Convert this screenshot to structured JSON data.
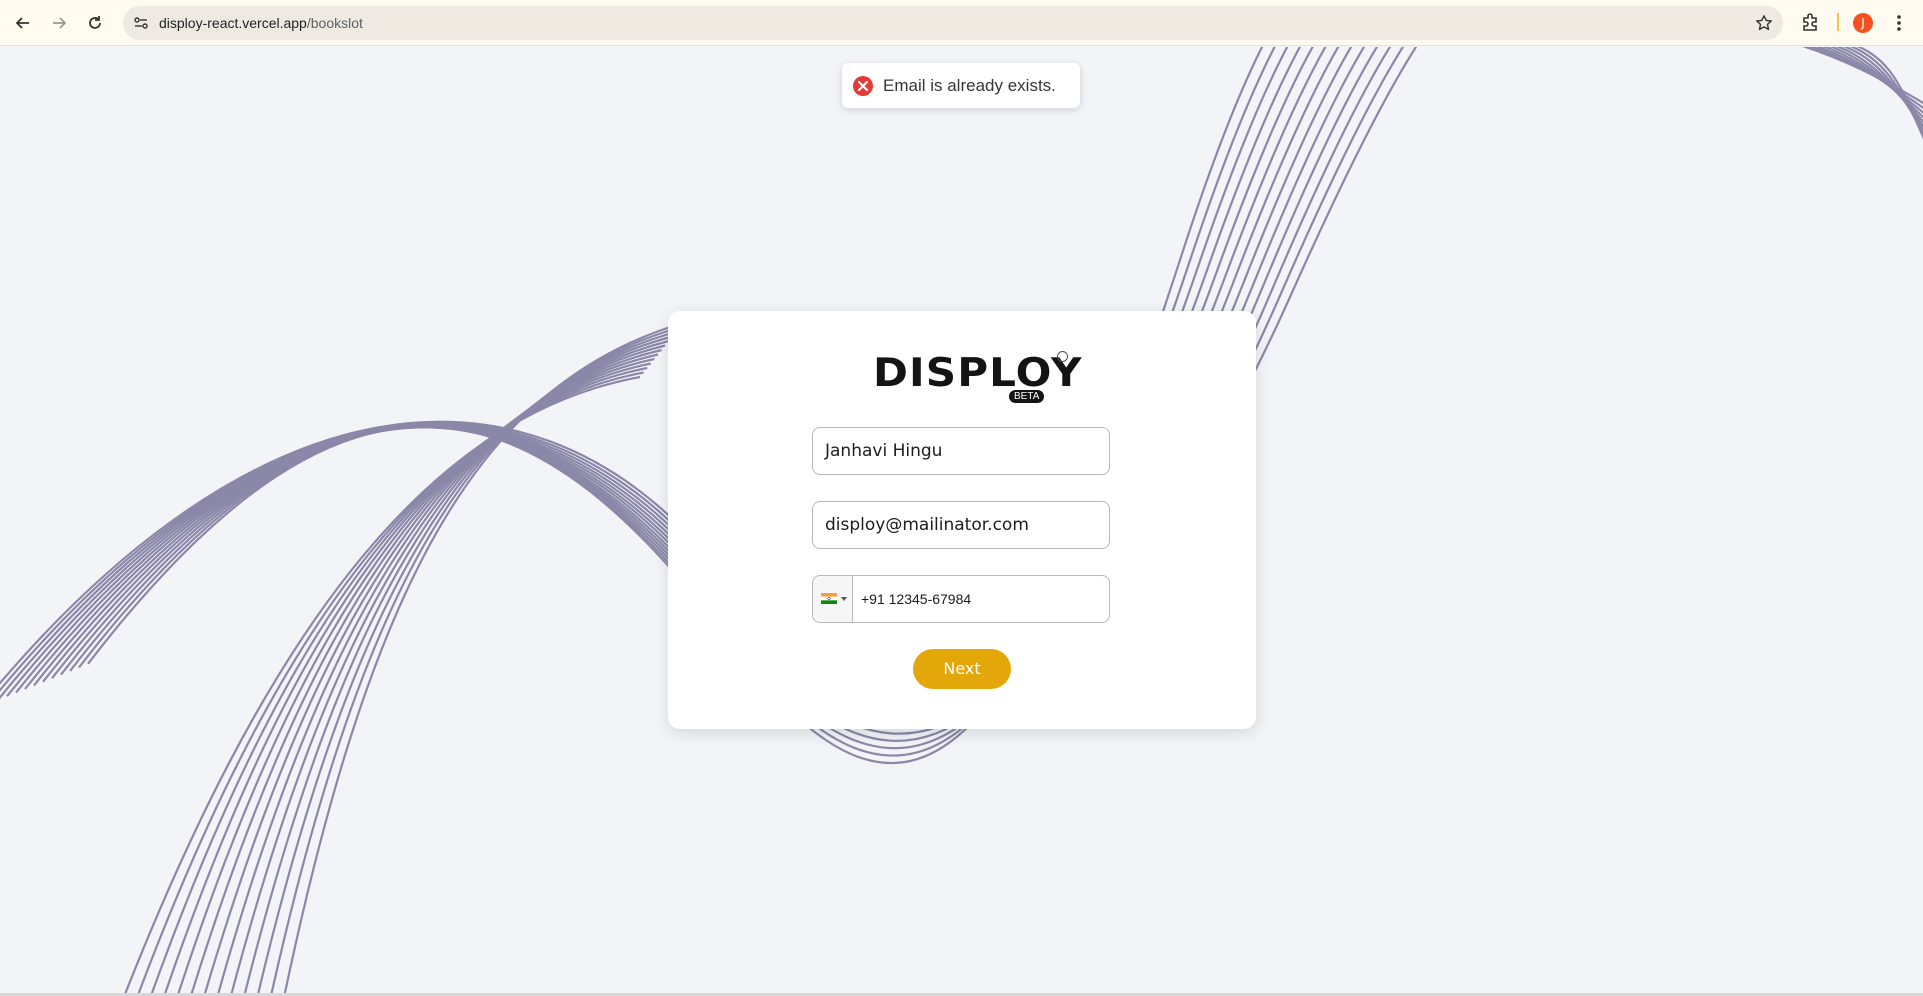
{
  "browser": {
    "url_host": "disploy-react.vercel.app",
    "url_path": "/bookslot",
    "avatar_initial": "J",
    "colors": {
      "avatar": "#f4511e",
      "chrome_bg": "#fffbf0"
    }
  },
  "toast": {
    "message": "Email is already exists.",
    "icon": "error-x-icon",
    "color": "#e53935"
  },
  "form": {
    "logo_text": "DISPLOY",
    "logo_badge": "BETA",
    "name_value": "Janhavi Hingu",
    "email_value": "disploy@mailinator.com",
    "phone_country": "India",
    "phone_value": "+91 12345-67984",
    "next_label": "Next",
    "colors": {
      "button": "#e4a70a",
      "background": "#f2f4f8",
      "waves": "#8a88a8"
    }
  }
}
